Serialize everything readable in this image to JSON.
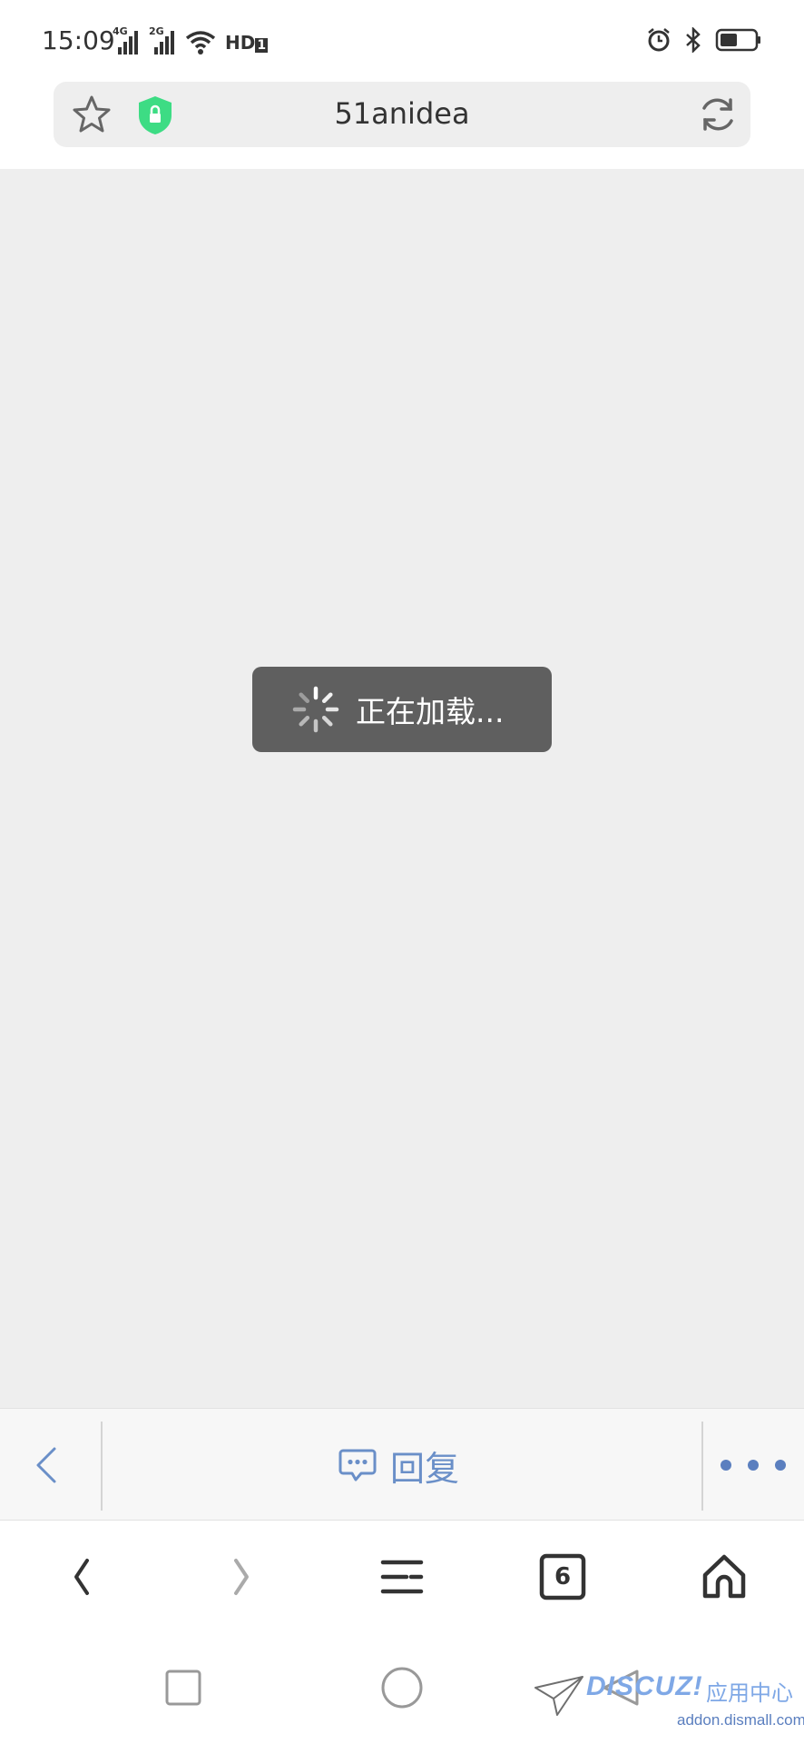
{
  "status_bar": {
    "time": "15:09",
    "sim1_tag": "4G",
    "sim2_tag": "2G",
    "hd_label": "HD",
    "hd_index": "1"
  },
  "url_bar": {
    "domain": "51anidea",
    "secure_color": "#3ddc84"
  },
  "content": {
    "loading_text": "正在加载..."
  },
  "reply_bar": {
    "reply_label": "回复",
    "accent_color": "#6a8fc8"
  },
  "browser_nav": {
    "tab_count": "6"
  },
  "watermark": {
    "logo_text": "DISCUZ!",
    "logo_cn": "应用中心",
    "domain": "addon.dismall.com"
  }
}
